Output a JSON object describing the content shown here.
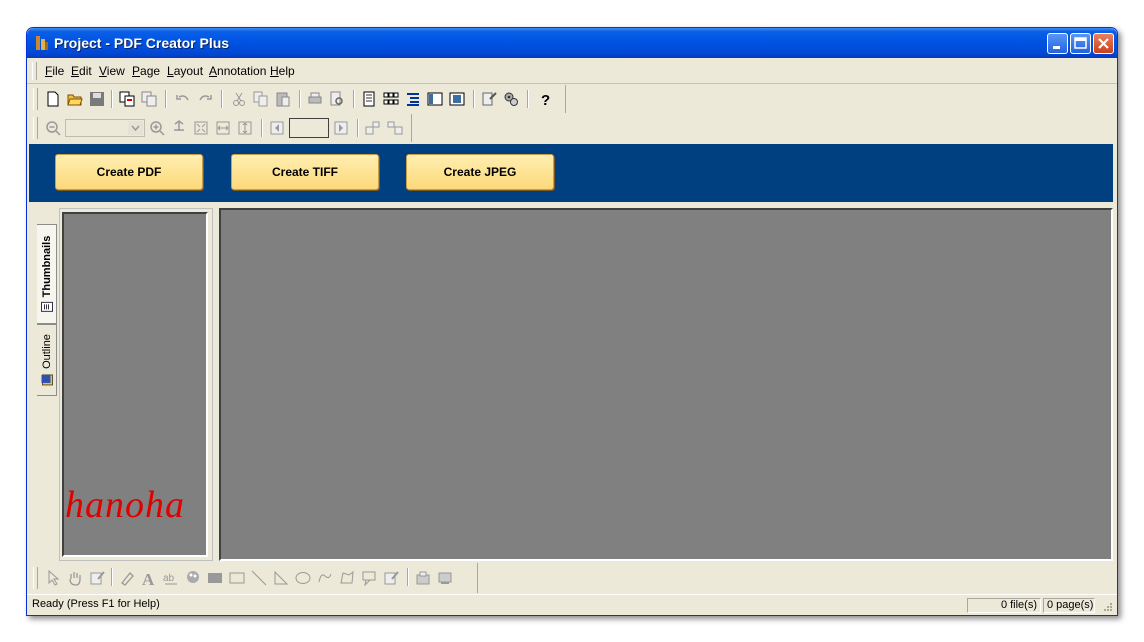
{
  "window": {
    "title": "Project - PDF Creator Plus"
  },
  "menu": [
    {
      "key": "F",
      "rest": "ile"
    },
    {
      "key": "E",
      "rest": "dit"
    },
    {
      "key": "V",
      "rest": "iew"
    },
    {
      "key": "P",
      "rest": "age"
    },
    {
      "key": "L",
      "rest": "ayout"
    },
    {
      "key": "A",
      "rest": "nnotation"
    },
    {
      "key": "H",
      "rest": "elp"
    }
  ],
  "actions": {
    "create_pdf": "Create PDF",
    "create_tiff": "Create TIFF",
    "create_jpeg": "Create JPEG"
  },
  "side_tabs": {
    "thumbnails": "Thumbnails",
    "outline": "Outline"
  },
  "watermark": "hanoha",
  "zoom": {
    "value": ""
  },
  "page_number": {
    "value": ""
  },
  "status": {
    "message": "Ready (Press F1 for Help)",
    "files": "0 file(s)",
    "pages": "0 page(s)"
  },
  "colors": {
    "title_bar": "#0054e3",
    "action_bar": "#003f80",
    "button_fill": "#fcd87a",
    "work_area": "#808080",
    "watermark": "#e00000"
  }
}
